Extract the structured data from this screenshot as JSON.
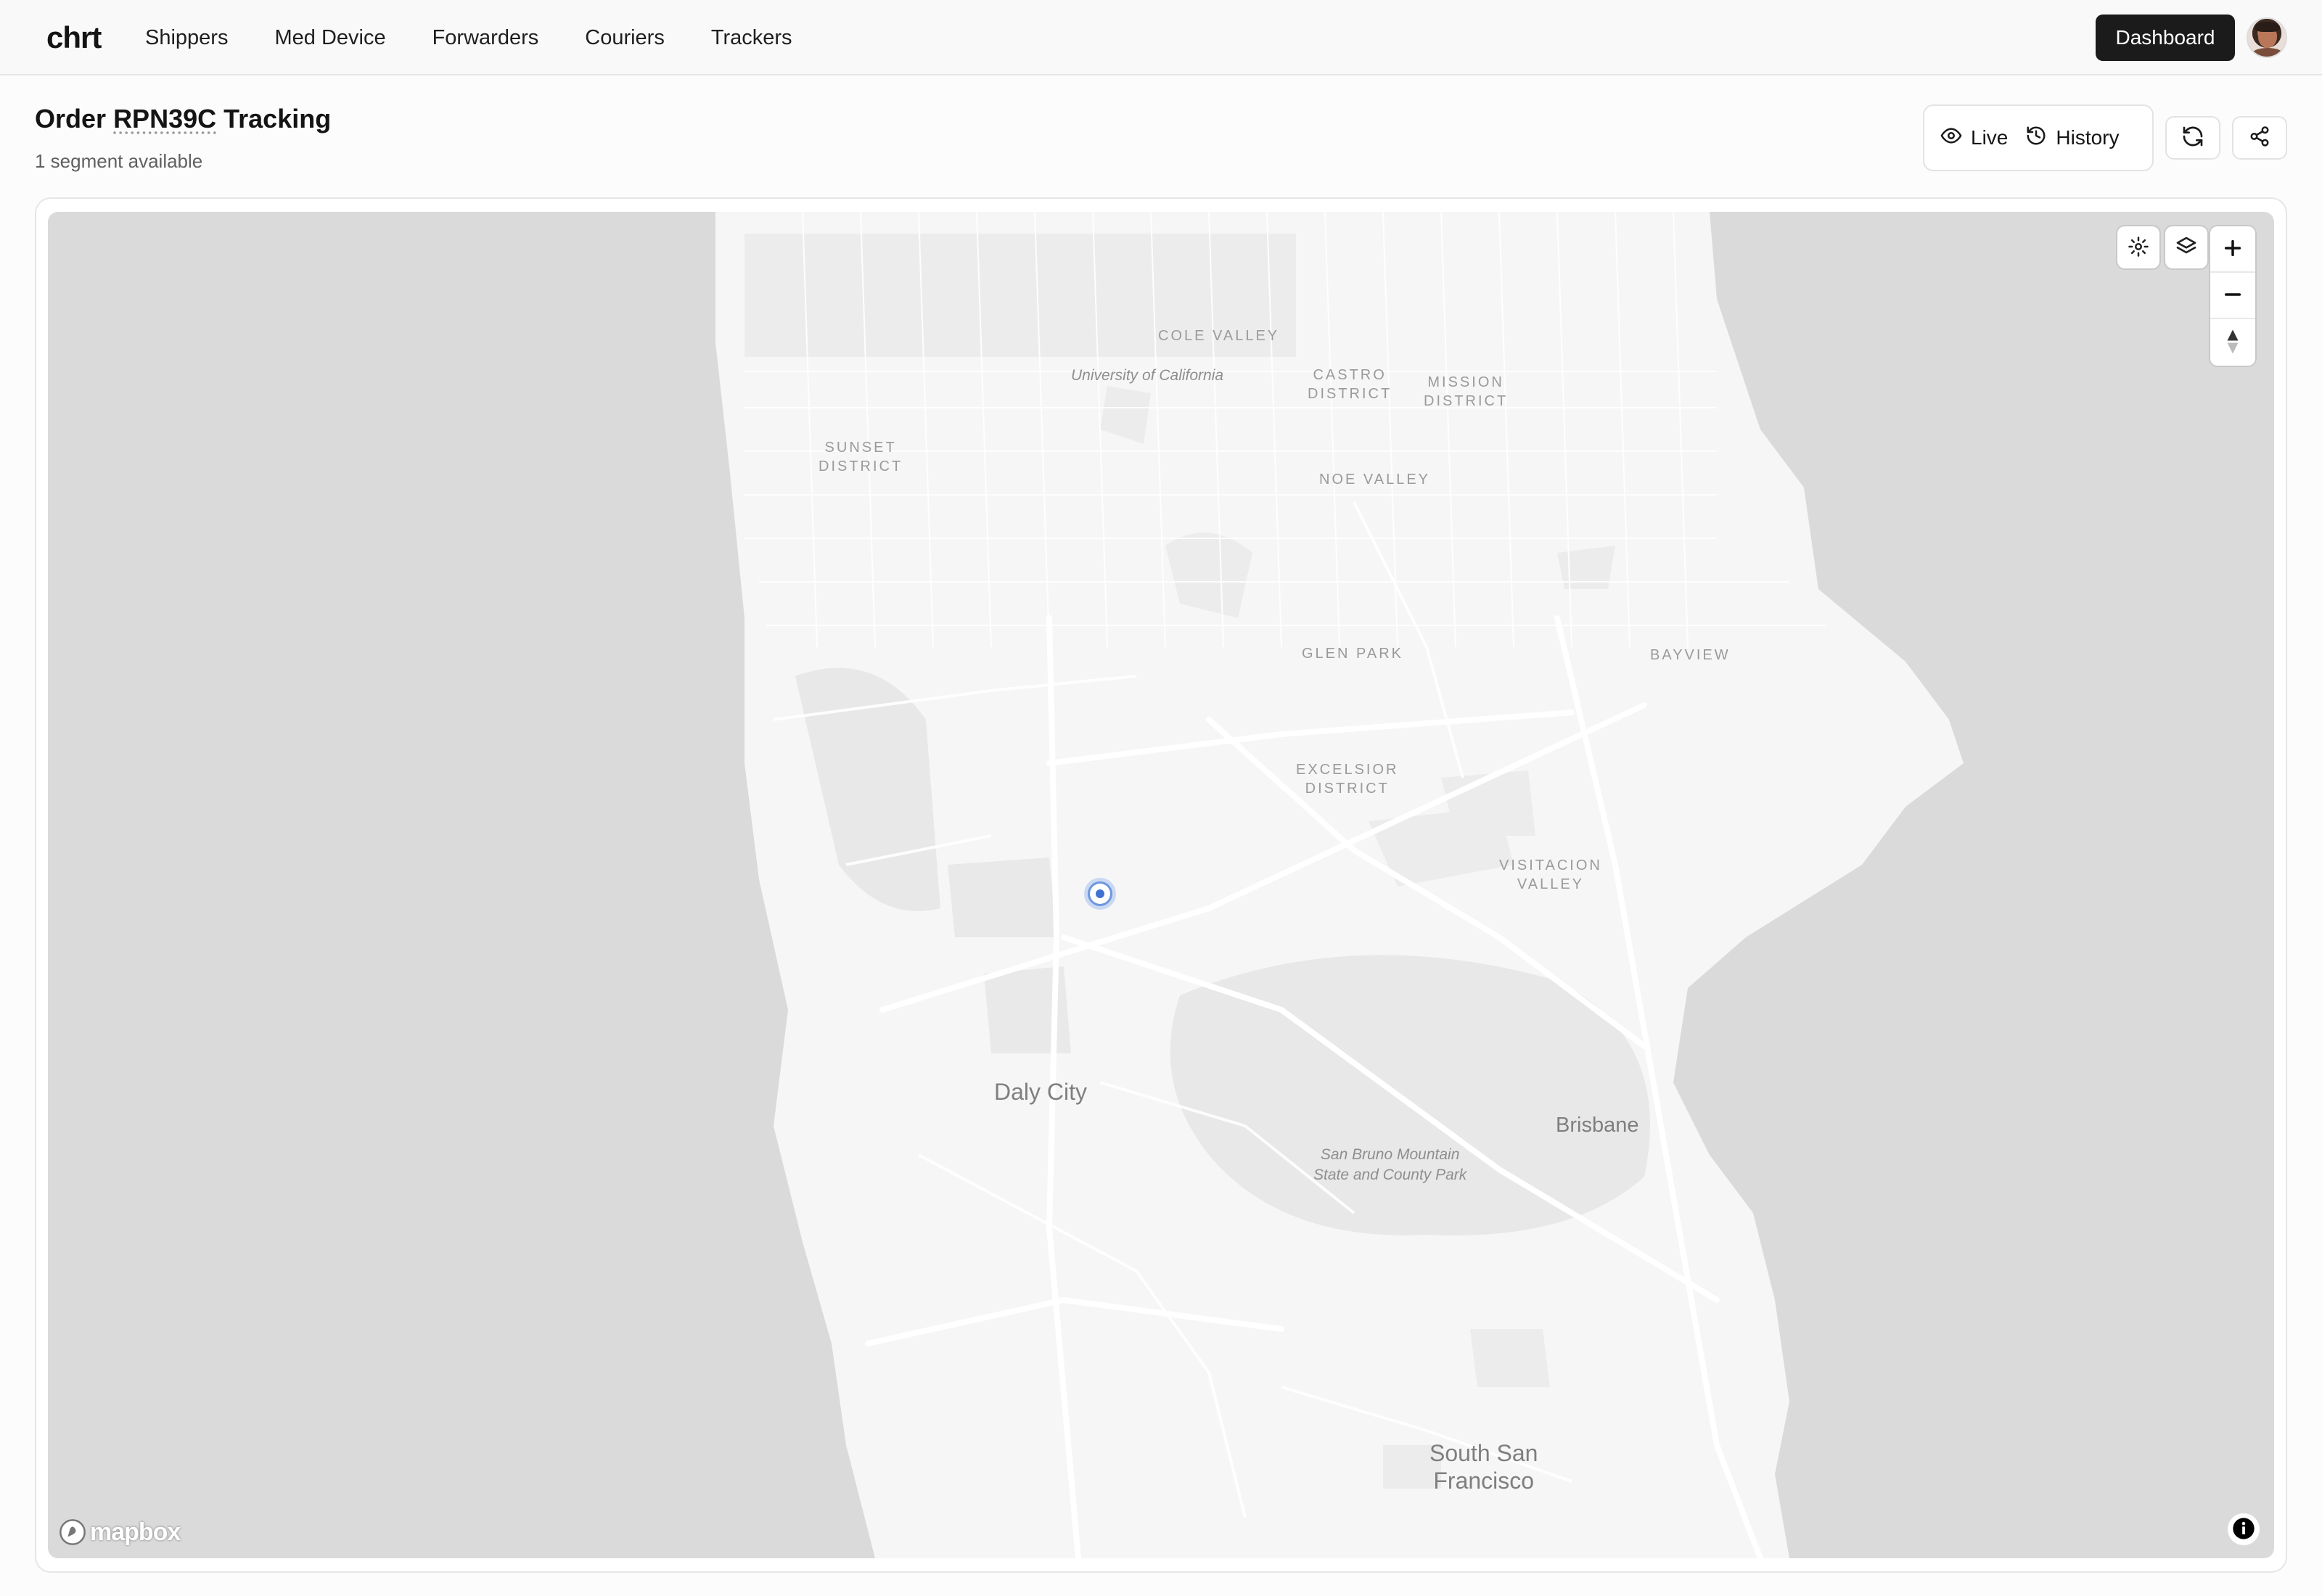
{
  "nav": {
    "brand": "chrt",
    "links": [
      "Shippers",
      "Med Device",
      "Forwarders",
      "Couriers",
      "Trackers"
    ],
    "dashboard_label": "Dashboard"
  },
  "header": {
    "title_prefix": "Order",
    "order_id": "RPN39C",
    "title_suffix": "Tracking",
    "subtitle": "1 segment available"
  },
  "view_toggle": {
    "live_label": "Live",
    "history_label": "History"
  },
  "icons": {
    "live": "eye-icon",
    "history": "history-icon",
    "refresh": "refresh-icon",
    "share": "share-icon",
    "settings": "gear-icon",
    "layers": "layers-icon",
    "zoom_in": "plus-icon",
    "zoom_out": "minus-icon",
    "compass": "compass-icon",
    "info": "info-icon"
  },
  "map": {
    "attribution": "mapbox",
    "labels": {
      "cole_valley": "COLE VALLEY",
      "uc": "University of California",
      "castro": "CASTRO\nDISTRICT",
      "mission": "MISSION\nDISTRICT",
      "sunset": "SUNSET\nDISTRICT",
      "noe": "NOE VALLEY",
      "glen_park": "GLEN PARK",
      "bayview": "BAYVIEW",
      "excelsior": "EXCELSIOR\nDISTRICT",
      "visitacion": "VISITACION\nVALLEY",
      "daly_city": "Daly City",
      "brisbane": "Brisbane",
      "san_bruno": "San Bruno Mountain\nState and County Park",
      "ssf": "South San\nFrancisco"
    }
  },
  "colors": {
    "water": "#dadada",
    "land": "#f6f6f6",
    "park": "#e9e9e9",
    "marker": "#3e73d4",
    "dashboard_bg": "#1b1b1b"
  }
}
